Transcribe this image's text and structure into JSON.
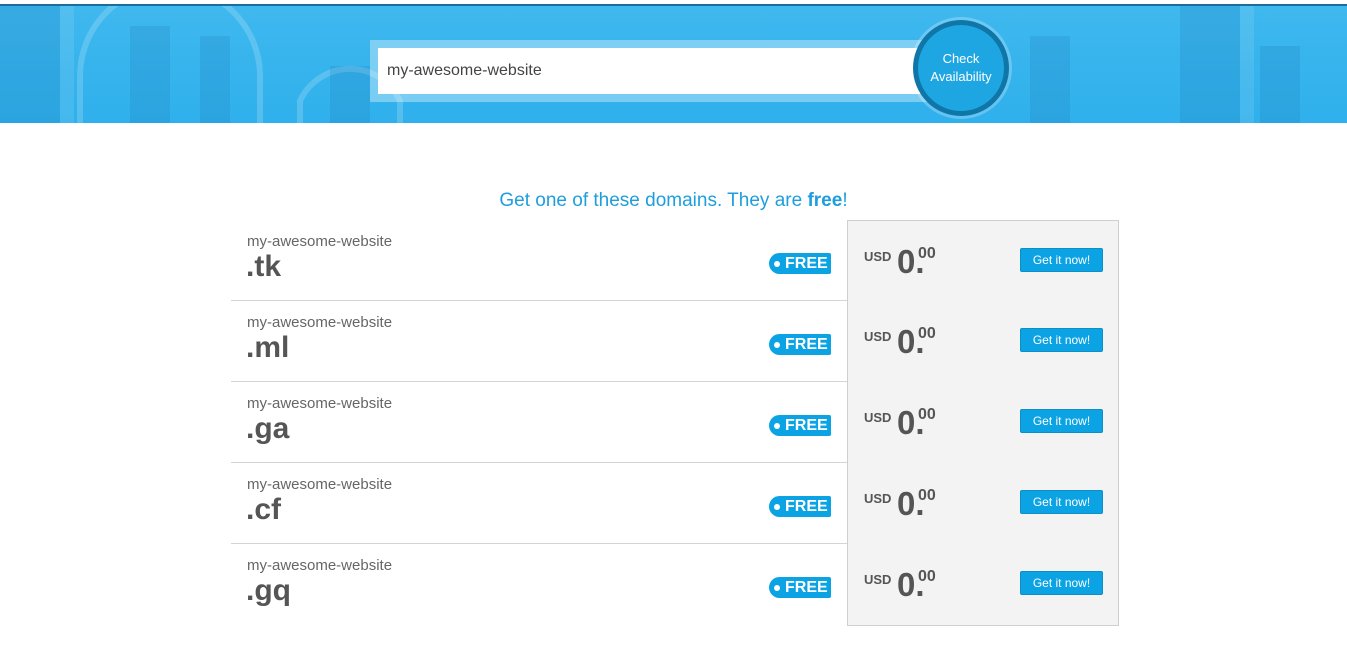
{
  "search": {
    "value": "my-awesome-website",
    "button_line1": "Check",
    "button_line2": "Availability"
  },
  "headline": {
    "prefix": "Get one of these domains. They are ",
    "emphasis": "free",
    "suffix": "!"
  },
  "domains": [
    {
      "name": "my-awesome-website",
      "tld": ".tk",
      "badge": "FREE",
      "currency": "USD",
      "amount": "0.",
      "cents": "00",
      "cta": "Get it now!"
    },
    {
      "name": "my-awesome-website",
      "tld": ".ml",
      "badge": "FREE",
      "currency": "USD",
      "amount": "0.",
      "cents": "00",
      "cta": "Get it now!"
    },
    {
      "name": "my-awesome-website",
      "tld": ".ga",
      "badge": "FREE",
      "currency": "USD",
      "amount": "0.",
      "cents": "00",
      "cta": "Get it now!"
    },
    {
      "name": "my-awesome-website",
      "tld": ".cf",
      "badge": "FREE",
      "currency": "USD",
      "amount": "0.",
      "cents": "00",
      "cta": "Get it now!"
    },
    {
      "name": "my-awesome-website",
      "tld": ".gq",
      "badge": "FREE",
      "currency": "USD",
      "amount": "0.",
      "cents": "00",
      "cta": "Get it now!"
    }
  ],
  "colors": {
    "hero": "#2fb0ec",
    "accent": "#0ba3e4",
    "check_button_ring": "#1076a8",
    "price_bg": "#f3f3f3"
  }
}
